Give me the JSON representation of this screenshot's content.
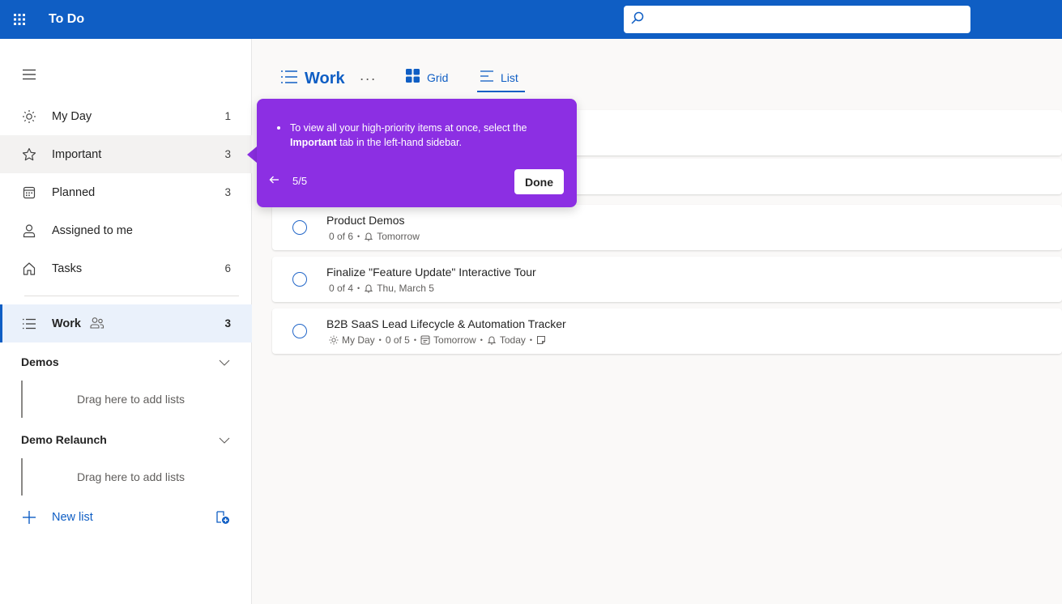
{
  "app": {
    "title": "To Do"
  },
  "search": {
    "placeholder": ""
  },
  "sidebar": {
    "items": [
      {
        "label": "My Day",
        "count": "1",
        "icon": "sun-icon"
      },
      {
        "label": "Important",
        "count": "3",
        "icon": "star-icon"
      },
      {
        "label": "Planned",
        "count": "3",
        "icon": "calendar-icon"
      },
      {
        "label": "Assigned to me",
        "count": "",
        "icon": "person-icon"
      },
      {
        "label": "Tasks",
        "count": "6",
        "icon": "home-icon"
      }
    ],
    "lists": [
      {
        "label": "Work",
        "count": "3",
        "icon": "list-icon",
        "shared_icon": "people-icon"
      }
    ],
    "groups": [
      {
        "label": "Demos",
        "drop_text": "Drag here to add lists"
      },
      {
        "label": "Demo Relaunch",
        "drop_text": "Drag here to add lists"
      }
    ],
    "new_list_label": "New list"
  },
  "main": {
    "title": "Work",
    "more": "···",
    "view_tabs": [
      {
        "label": "Grid",
        "active": false
      },
      {
        "label": "List",
        "active": true
      }
    ],
    "tasks": [
      {
        "title": "Product Demos",
        "meta": [
          {
            "text": "0 of 6"
          },
          {
            "icon": "bell-icon",
            "text": "Tomorrow"
          }
        ]
      },
      {
        "title": "Finalize \"Feature Update\" Interactive Tour",
        "meta": [
          {
            "text": "0 of 4"
          },
          {
            "icon": "bell-icon",
            "text": "Thu, March 5"
          }
        ]
      },
      {
        "title": "B2B SaaS Lead Lifecycle & Automation Tracker",
        "meta": [
          {
            "icon": "sun-icon",
            "text": "My Day"
          },
          {
            "text": "0 of 5"
          },
          {
            "icon": "calendar-icon",
            "text": "Tomorrow"
          },
          {
            "icon": "bell-icon",
            "text": "Today"
          },
          {
            "icon": "note-icon",
            "text": ""
          }
        ]
      }
    ]
  },
  "tooltip": {
    "text_before": "To view all your high-priority items at once, select the ",
    "text_bold": "Important",
    "text_after": " tab in the left-hand sidebar.",
    "step": "5/5",
    "done_label": "Done"
  },
  "colors": {
    "brand": "#0f5ec4",
    "tooltip": "#8c2fe3",
    "selected_bg": "#eaf1fb"
  }
}
